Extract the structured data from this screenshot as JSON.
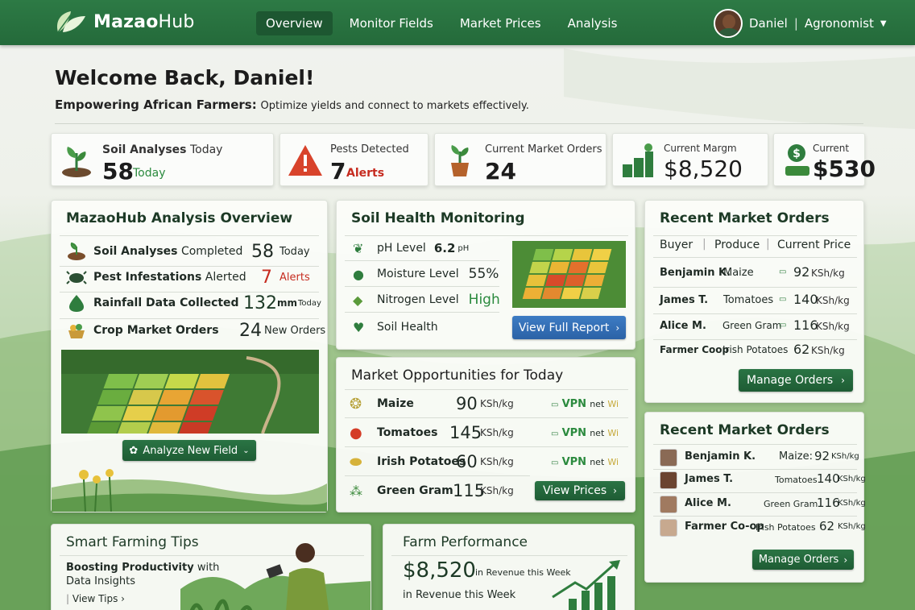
{
  "brand": {
    "name_a": "Mazao",
    "name_b": "Hub"
  },
  "nav": {
    "items": [
      "Overview",
      "Monitor Fields",
      "Market Prices",
      "Analysis"
    ],
    "active": "Overview"
  },
  "user": {
    "name": "Daniel",
    "role": "Agronomist",
    "separator": "|"
  },
  "welcome": {
    "title": "Welcome Back, Daniel!",
    "tagline_bold": "Empowering African Farmers:",
    "tagline_rest": "Optimize yields and connect to markets effectively."
  },
  "stats": [
    {
      "label": "Soil Analyses",
      "label_suffix": "Today",
      "value": "58",
      "suffix": "Today"
    },
    {
      "label": "Pests Detected",
      "value": "7",
      "suffix": "Alerts"
    },
    {
      "label": "Current Market Orders",
      "value": "24"
    },
    {
      "label": "Current Margm",
      "value": "$8,520"
    },
    {
      "label": "Current",
      "value": "$530"
    }
  ],
  "overview": {
    "title": "MazaoHub Analysis Overview",
    "rows": [
      {
        "label_bold": "Soil Analyses",
        "label_rest": "Completed",
        "value": "58",
        "unit": "Today"
      },
      {
        "label_bold": "Pest Infestations",
        "label_rest": "Alerted",
        "value": "7",
        "unit": "Alerts"
      },
      {
        "label_bold": "Rainfall Data Collected",
        "label_rest": "",
        "value": "132",
        "unit": "mm",
        "unit2": "Today"
      },
      {
        "label_bold": "Crop Market Orders",
        "label_rest": "",
        "value": "24",
        "unit": "New Orders"
      }
    ],
    "button": "Analyze New Field"
  },
  "soil": {
    "title": "Soil Health Monitoring",
    "rows": [
      {
        "label": "pH Level",
        "value": "6.2",
        "unit": "pH"
      },
      {
        "label": "Moisture Level",
        "value": "55%"
      },
      {
        "label": "Nitrogen Level",
        "value": "High"
      },
      {
        "label": "Soil Health",
        "value": ""
      }
    ],
    "button": "View Full Report"
  },
  "orders1": {
    "title": "Recent Market Orders",
    "headers": [
      "Buyer",
      "Produce",
      "Current Price"
    ],
    "rows": [
      {
        "buyer": "Benjamin K.",
        "produce": "Maize",
        "price": "92",
        "unit": "KSh/kg"
      },
      {
        "buyer": "James T.",
        "produce": "Tomatoes",
        "price": "140",
        "unit": "KSh/kg"
      },
      {
        "buyer": "Alice M.",
        "produce": "Green Gram",
        "price": "116",
        "unit": "KSh/kg"
      },
      {
        "buyer": "Farmer Coop",
        "produce": "Irish Potatoes",
        "price": "62",
        "unit": "KSh/kg"
      }
    ],
    "button": "Manage Orders"
  },
  "opps": {
    "title": "Market Opportunities for Today",
    "rows": [
      {
        "crop": "Maize",
        "price": "90",
        "unit": "KSh/kg",
        "tag_a": "VPN",
        "tag_b": "net",
        "tag_c": "Wi"
      },
      {
        "crop": "Tomatoes",
        "price": "145",
        "unit": "KSh/kg",
        "tag_a": "VPN",
        "tag_b": "net",
        "tag_c": "Wi"
      },
      {
        "crop": "Irish Potatoes",
        "price": "60",
        "unit": "KSh/kg",
        "tag_a": "VPN",
        "tag_b": "net",
        "tag_c": "Wi"
      },
      {
        "crop": "Green Gram",
        "price": "115",
        "unit": "KSh/kg"
      }
    ],
    "button": "View Prices"
  },
  "orders2": {
    "title": "Recent Market Orders",
    "rows": [
      {
        "buyer": "Benjamin K.",
        "produce": "Maize:",
        "price": "92",
        "unit": "KSh/kg"
      },
      {
        "buyer": "James T.",
        "produce": "Tomatoes",
        "price": "140",
        "unit": "KSh/kg"
      },
      {
        "buyer": "Alice M.",
        "produce": "Green Gram",
        "price": "116",
        "unit": "KSh/kg"
      },
      {
        "buyer": "Farmer Co-op",
        "produce": "Irish Potatoes",
        "price": "62",
        "unit": "KSh/kg"
      }
    ],
    "button": "Manage Orders"
  },
  "tips": {
    "title": "Smart Farming Tips",
    "line1_bold": "Boosting Productivity",
    "line1_rest": "with",
    "line2": "Data Insights",
    "link": "View Tips"
  },
  "perf": {
    "title": "Farm Performance",
    "value": "$8,520",
    "value_note": "in Revenue this Week",
    "note2": "in Revenue this Week"
  },
  "colors": {
    "primary": "#246a3a",
    "accent_blue": "#2b62a6",
    "alert_red": "#c62b1f"
  }
}
